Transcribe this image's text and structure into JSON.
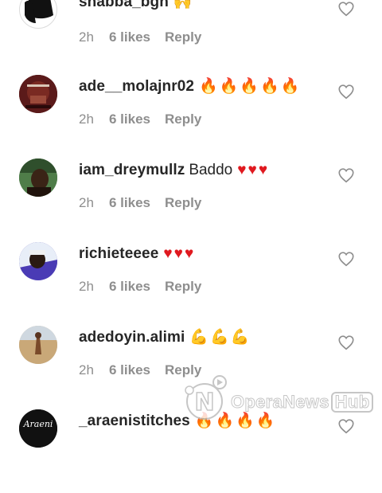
{
  "comments": [
    {
      "username": "shabba_bgn",
      "text": "",
      "emoji": "🙌",
      "emoji_class": "emoji-muscle",
      "time": "2h",
      "likes": "6 likes",
      "reply": "Reply",
      "avatar_icon": "black-silhouette-avatar"
    },
    {
      "username": "ade__molajnr02",
      "text": "",
      "emoji": "🔥🔥🔥🔥🔥",
      "emoji_class": "emoji-fire",
      "time": "2h",
      "likes": "6 likes",
      "reply": "Reply",
      "avatar_icon": "album-cover-avatar"
    },
    {
      "username": "iam_dreymullz",
      "text": "Baddo",
      "emoji": "♥♥♥",
      "emoji_class": "emoji-heart",
      "time": "2h",
      "likes": "6 likes",
      "reply": "Reply",
      "avatar_icon": "photo-avatar"
    },
    {
      "username": "richieteeee",
      "text": "",
      "emoji": "♥♥♥",
      "emoji_class": "emoji-heart",
      "time": "2h",
      "likes": "6 likes",
      "reply": "Reply",
      "avatar_icon": "photo-avatar"
    },
    {
      "username": "adedoyin.alimi",
      "text": "",
      "emoji": "💪💪💪",
      "emoji_class": "emoji-muscle",
      "time": "2h",
      "likes": "6 likes",
      "reply": "Reply",
      "avatar_icon": "beach-photo-avatar"
    },
    {
      "username": "_araenistitches",
      "text": "",
      "emoji": "🔥🔥🔥🔥",
      "emoji_class": "emoji-fire",
      "time": "",
      "likes": "",
      "reply": "",
      "avatar_icon": "logo-avatar"
    }
  ],
  "watermark": {
    "brand": "OperaNews",
    "suffix": "Hub"
  },
  "colors": {
    "username": "#262626",
    "meta": "#8e8e8e",
    "heart_outline": "#8e8e8e"
  }
}
